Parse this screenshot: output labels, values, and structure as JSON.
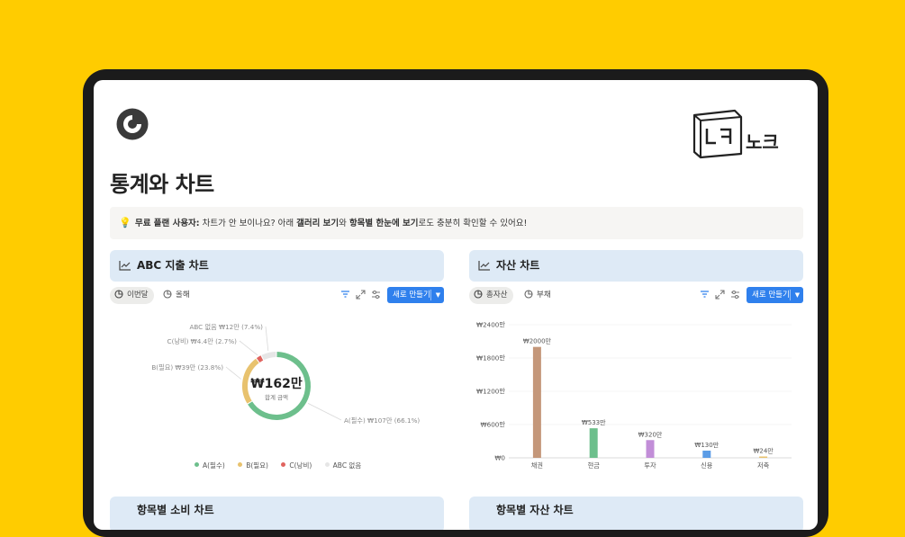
{
  "page": {
    "title": "통계와 차트",
    "brand": "노크"
  },
  "callout": {
    "prefix": "무료 플랜 사용자:",
    "text1": " 차트가 안 보이나요? 아래 ",
    "gallery": "갤러리 보기",
    "text2": "와 ",
    "itemview": "항목별 한눈에 보기",
    "text3": "로도 충분히 확인할 수 있어요!"
  },
  "left_panel": {
    "title": "ABC 지출 차트",
    "tabs": [
      {
        "label": "이번달"
      },
      {
        "label": "올해"
      }
    ],
    "new_button": "새로 만들기"
  },
  "right_panel": {
    "title": "자산 차트",
    "tabs": [
      {
        "label": "총자산"
      },
      {
        "label": "부채"
      }
    ],
    "new_button": "새로 만들기"
  },
  "bottom_panels": {
    "left_title": "항목별 소비 차트",
    "right_title": "항목별 자산 차트"
  },
  "colors": {
    "a": "#6dbf8c",
    "b": "#e8c26e",
    "c": "#e0645f",
    "none": "#e6e6e6",
    "button": "#2f80ed",
    "panel_head": "#deeaf6"
  },
  "chart_data": [
    {
      "type": "pie",
      "center_value": "₩162만",
      "center_label": "합계 금액",
      "slices": [
        {
          "name": "A(필수)",
          "value": 107,
          "percent": 66.1,
          "label": "A(필수) ₩107만 (66.1%)",
          "color": "#6dbf8c"
        },
        {
          "name": "B(필요)",
          "value": 39,
          "percent": 23.8,
          "label": "B(필요) ₩39만 (23.8%)",
          "color": "#e8c26e"
        },
        {
          "name": "C(낭비)",
          "value": 4.4,
          "percent": 2.7,
          "label": "C(낭비) ₩4.4만 (2.7%)",
          "color": "#e0645f"
        },
        {
          "name": "ABC 없음",
          "value": 12,
          "percent": 7.4,
          "label": "ABC 없음 ₩12만 (7.4%)",
          "color": "#e6e6e6"
        }
      ],
      "legend": [
        "A(필수)",
        "B(필요)",
        "C(낭비)",
        "ABC 없음"
      ]
    },
    {
      "type": "bar",
      "categories": [
        "채권",
        "현금",
        "투자",
        "신용",
        "저축"
      ],
      "values": [
        2000,
        533,
        320,
        130,
        24
      ],
      "labels": [
        "₩2000만",
        "₩533만",
        "₩320만",
        "₩130만",
        "₩24만"
      ],
      "colors": [
        "#c4977a",
        "#6dbf8c",
        "#c28ed8",
        "#5b9ce6",
        "#e8c26e"
      ],
      "yticks": [
        "₩0",
        "₩600만",
        "₩1200만",
        "₩1800만",
        "₩2400만"
      ],
      "ylim": [
        0,
        2400
      ]
    }
  ]
}
